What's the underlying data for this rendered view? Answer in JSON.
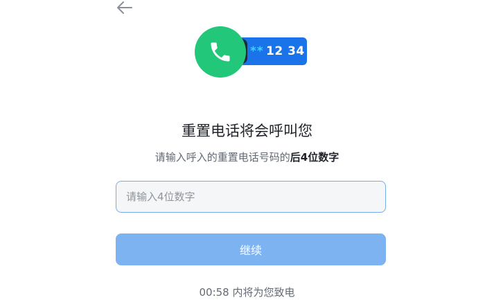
{
  "header": {
    "back_icon": "arrow-left-icon"
  },
  "hero": {
    "phone_icon": "phone-icon",
    "masked_prefix": "**",
    "number_suffix": "12 34",
    "colors": {
      "circle": "#22c77a",
      "pill": "#1a73e8",
      "stars": "#38d6ff"
    }
  },
  "main": {
    "title": "重置电话将会呼叫您",
    "subtitle_prefix": "请输入呼入的重置电话号码的",
    "subtitle_emphasis": "后4位数字"
  },
  "form": {
    "code_placeholder": "请输入4位数字",
    "code_value": "",
    "continue_label": "继续"
  },
  "footer": {
    "countdown_time": "00:58",
    "countdown_text": "内将为您致电"
  },
  "theme": {
    "accent": "#1a73e8",
    "button_disabled": "#7eb3f2",
    "input_border": "#74aee8"
  }
}
